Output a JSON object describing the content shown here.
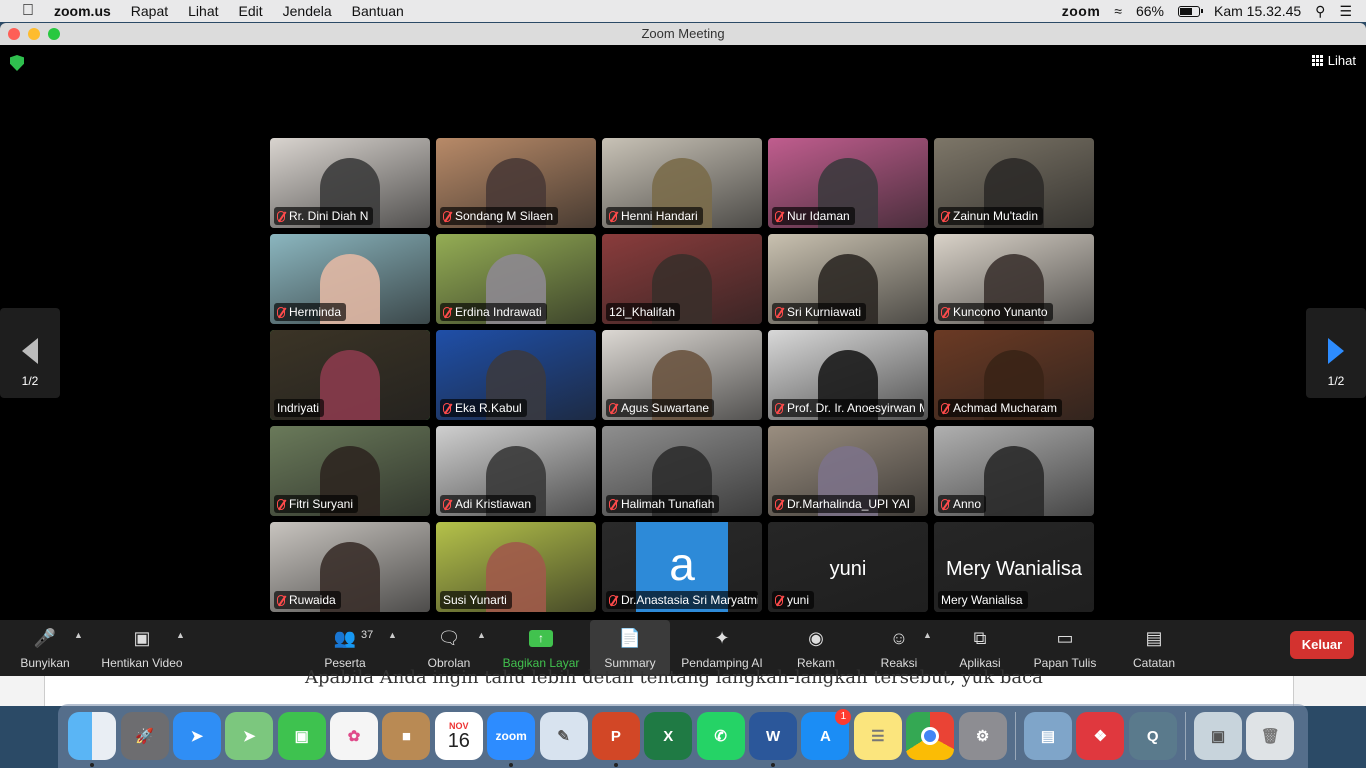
{
  "menubar": {
    "app": "zoom.us",
    "items": [
      "Rapat",
      "Lihat",
      "Edit",
      "Jendela",
      "Bantuan"
    ],
    "zoom_status": "zoom",
    "battery": "66%",
    "clock": "Kam 15.32.45"
  },
  "window": {
    "title": "Zoom Meeting",
    "view_label": "Lihat",
    "page_indicator": "1/2"
  },
  "participants": [
    {
      "name": "Rr. Dini Diah N",
      "muted": true,
      "bg": "#d9d4cf",
      "skin": "#3c3c3c"
    },
    {
      "name": "Sondang M Silaen",
      "muted": true,
      "bg": "#b88a68",
      "skin": "#4a3a36"
    },
    {
      "name": "Henni Handari",
      "muted": true,
      "bg": "#c8c2b6",
      "skin": "#7a6b4a"
    },
    {
      "name": "Nur Idaman",
      "muted": true,
      "bg": "#c05d8e",
      "skin": "#3d3a3e"
    },
    {
      "name": "Zainun Mu'tadin",
      "muted": true,
      "bg": "#7d7668",
      "skin": "#2c2a28"
    },
    {
      "name": "Herminda",
      "muted": true,
      "bg": "#8bb6bf",
      "skin": "#e1b8a4"
    },
    {
      "name": "Erdina Indrawati",
      "muted": true,
      "bg": "#94ad54",
      "skin": "#8d8890"
    },
    {
      "name": "12i_Khalifah",
      "muted": false,
      "bg": "#8a3c3c",
      "skin": "#3a2f2a"
    },
    {
      "name": "Sri Kurniawati",
      "muted": true,
      "bg": "#c9c1b0",
      "skin": "#2d2925"
    },
    {
      "name": "Kuncono Yunanto",
      "muted": true,
      "bg": "#d9d2c8",
      "skin": "#3c3330"
    },
    {
      "name": "Indriyati",
      "muted": false,
      "bg": "#3b3426",
      "skin": "#8a3b4d"
    },
    {
      "name": "Eka R.Kabul",
      "muted": true,
      "bg": "#1f4fa8",
      "skin": "#3a3a40"
    },
    {
      "name": "Agus Suwartane",
      "muted": true,
      "bg": "#dcd8d3",
      "skin": "#6a5440"
    },
    {
      "name": "Prof. Dr. Ir. Anoesyirwan MM",
      "muted": true,
      "bg": "#d8d8d8",
      "skin": "#1b1b1b"
    },
    {
      "name": "Achmad Mucharam",
      "muted": true,
      "bg": "#6b3a24",
      "skin": "#3a2416"
    },
    {
      "name": "Fitri Suryani",
      "muted": true,
      "bg": "#6a7a5a",
      "skin": "#2e2620"
    },
    {
      "name": "Adi Kristiawan",
      "muted": true,
      "bg": "#cfcfcf",
      "skin": "#3a3a3a"
    },
    {
      "name": "Halimah Tunafiah",
      "muted": true,
      "bg": "#8f8f8f",
      "skin": "#2e2e2e"
    },
    {
      "name": "Dr.Marhalinda_UPI YAI",
      "muted": true,
      "bg": "#9a8e80",
      "skin": "#7c7288"
    },
    {
      "name": "Anno",
      "muted": true,
      "bg": "#b0b0b0",
      "skin": "#2a2a2a"
    },
    {
      "name": "Ruwaida",
      "muted": true,
      "bg": "#c8c4bf",
      "skin": "#3a2f2a"
    },
    {
      "name": "Susi Yunarti",
      "muted": false,
      "bg": "#b5c24a",
      "skin": "#a05a4a"
    },
    {
      "name": "Dr.Anastasia Sri Maryatmi",
      "muted": true,
      "bg": "#2a2a2a",
      "avatar_letter": "a"
    },
    {
      "name": "yuni",
      "muted": true,
      "bg": "#262626",
      "center_name": "yuni"
    },
    {
      "name": "Mery Wanialisa",
      "muted": false,
      "bg": "#262626",
      "center_name": "Mery Wanialisa"
    }
  ],
  "toolbar": {
    "mute": "Bunyikan",
    "video": "Hentikan Video",
    "participants": "Peserta",
    "participants_count": "37",
    "chat": "Obrolan",
    "share": "Bagikan Layar",
    "summary": "Summary",
    "ai": "Pendamping AI",
    "record": "Rekam",
    "reactions": "Reaksi",
    "apps": "Aplikasi",
    "whiteboard": "Papan Tulis",
    "notes": "Catatan",
    "leave": "Keluar"
  },
  "background_page_text": "Apabila Anda ingin tahu lebih detail tentang langkah-langkah tersebut, yuk baca",
  "dock": {
    "calendar_month": "NOV",
    "calendar_day": "16",
    "zoom_label": "zoom",
    "appstore_badge": "1"
  }
}
